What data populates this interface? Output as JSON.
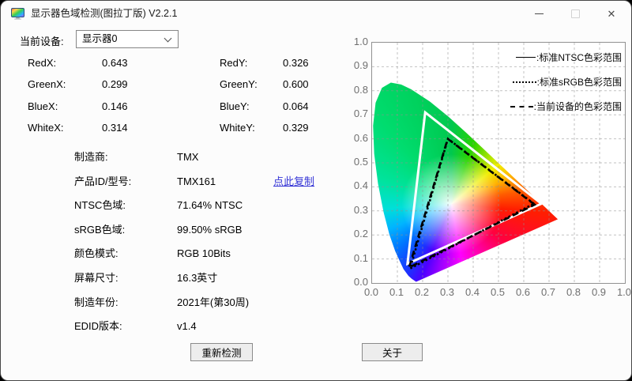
{
  "window": {
    "title": "显示器色域检测(图拉丁版) V2.2.1",
    "controls": {
      "close": "✕"
    }
  },
  "device_selector": {
    "label": "当前设备:",
    "value": "显示器0"
  },
  "coords_left": [
    {
      "label": "RedX:",
      "value": "0.643"
    },
    {
      "label": "GreenX:",
      "value": "0.299"
    },
    {
      "label": "BlueX:",
      "value": "0.146"
    },
    {
      "label": "WhiteX:",
      "value": "0.314"
    }
  ],
  "coords_right": [
    {
      "label": "RedY:",
      "value": "0.326"
    },
    {
      "label": "GreenY:",
      "value": "0.600"
    },
    {
      "label": "BlueY:",
      "value": "0.064"
    },
    {
      "label": "WhiteY:",
      "value": "0.329"
    }
  ],
  "info": [
    {
      "label": "制造商:",
      "value": "TMX"
    },
    {
      "label": "产品ID/型号:",
      "value": "TMX161",
      "link": "点此复制"
    },
    {
      "label": "NTSC色域:",
      "value": "71.64% NTSC"
    },
    {
      "label": "sRGB色域:",
      "value": "99.50% sRGB"
    },
    {
      "label": "颜色模式:",
      "value": "RGB 10Bits"
    },
    {
      "label": "屏幕尺寸:",
      "value": "16.3英寸"
    },
    {
      "label": "制造年份:",
      "value": "2021年(第30周)"
    },
    {
      "label": "EDID版本:",
      "value": "v1.4"
    }
  ],
  "buttons": {
    "redetect": "重新检测",
    "about": "关于"
  },
  "colors": {
    "link": "#3434d6"
  },
  "chart_data": {
    "type": "chromaticity-diagram",
    "title": "",
    "xlabel": "",
    "ylabel": "",
    "xlim": [
      0,
      1
    ],
    "ylim": [
      0,
      1
    ],
    "grid": true,
    "legend_position": "top-right",
    "x_ticks": [
      "0.0",
      "0.1",
      "0.2",
      "0.3",
      "0.4",
      "0.5",
      "0.6",
      "0.7",
      "0.8",
      "0.9",
      "1.0"
    ],
    "y_ticks": [
      "0.0",
      "0.1",
      "0.2",
      "0.3",
      "0.4",
      "0.5",
      "0.6",
      "0.7",
      "0.8",
      "0.9",
      "1.0"
    ],
    "white_point": [
      0.314,
      0.329
    ],
    "series": [
      {
        "name": "标准NTSC色彩范围",
        "style": "solid",
        "stroke": "#ffffff",
        "points": [
          [
            0.67,
            0.33
          ],
          [
            0.21,
            0.71
          ],
          [
            0.14,
            0.08
          ]
        ]
      },
      {
        "name": "标准sRGB色彩范围",
        "style": "dotted",
        "stroke": "#000000",
        "points": [
          [
            0.64,
            0.33
          ],
          [
            0.3,
            0.6
          ],
          [
            0.15,
            0.06
          ]
        ]
      },
      {
        "name": "当前设备的色彩范围",
        "style": "dashed",
        "stroke": "#000000",
        "points": [
          [
            0.643,
            0.326
          ],
          [
            0.299,
            0.6
          ],
          [
            0.146,
            0.064
          ]
        ]
      }
    ],
    "locus": [
      [
        0.1741,
        0.005
      ],
      [
        0.1566,
        0.0177
      ],
      [
        0.144,
        0.0297
      ],
      [
        0.1241,
        0.0578
      ],
      [
        0.0913,
        0.1327
      ],
      [
        0.0687,
        0.2007
      ],
      [
        0.0454,
        0.295
      ],
      [
        0.0235,
        0.4127
      ],
      [
        0.0082,
        0.5384
      ],
      [
        0.0039,
        0.6548
      ],
      [
        0.0139,
        0.7502
      ],
      [
        0.0389,
        0.812
      ],
      [
        0.0743,
        0.8338
      ],
      [
        0.1142,
        0.8262
      ],
      [
        0.1547,
        0.8059
      ],
      [
        0.2296,
        0.7543
      ],
      [
        0.3016,
        0.6923
      ],
      [
        0.3731,
        0.6245
      ],
      [
        0.4441,
        0.5547
      ],
      [
        0.5125,
        0.4866
      ],
      [
        0.5752,
        0.4242
      ],
      [
        0.627,
        0.3725
      ],
      [
        0.6658,
        0.334
      ],
      [
        0.6915,
        0.3083
      ],
      [
        0.714,
        0.2859
      ],
      [
        0.7347,
        0.2653
      ]
    ]
  }
}
